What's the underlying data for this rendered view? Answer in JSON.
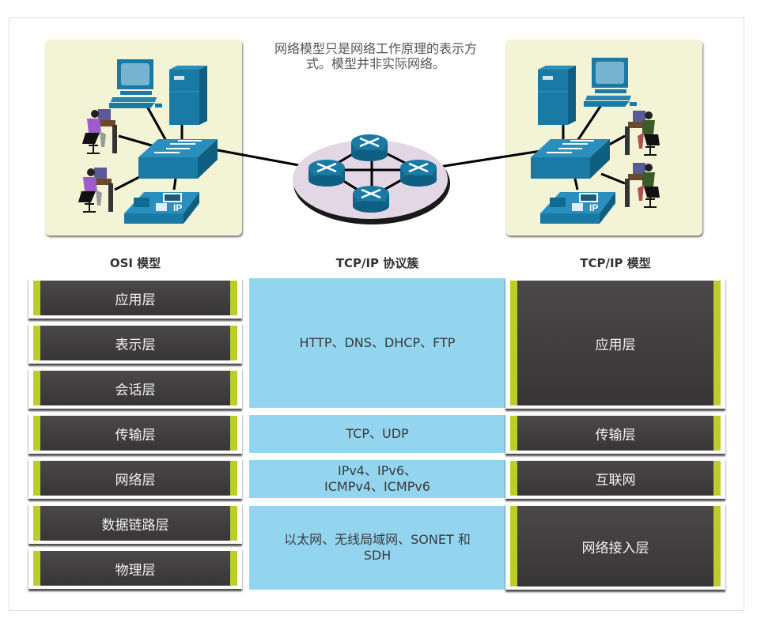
{
  "caption": "网络模型只是网络工作原理的表示方式。模型并非实际网络。",
  "caption_lines": [
    "网络模型只是网络工作原理的表示方",
    "式。模型并非实际网络。"
  ],
  "headers": {
    "osi": "OSI 模型",
    "suite": "TCP/IP 协议簇",
    "tcpip": "TCP/IP 模型"
  },
  "osi_layers": [
    {
      "label": "应用层"
    },
    {
      "label": "表示层"
    },
    {
      "label": "会话层"
    },
    {
      "label": "传输层"
    },
    {
      "label": "网络层"
    },
    {
      "label": "数据链路层"
    },
    {
      "label": "物理层"
    }
  ],
  "protocols": [
    {
      "lines": [
        "HTTP、DNS、DHCP、FTP"
      ]
    },
    {
      "lines": [
        "TCP、UDP"
      ]
    },
    {
      "lines": [
        "IPv4、IPv6、",
        "ICMPv4、ICMPv6"
      ]
    },
    {
      "lines": [
        "以太网、无线局域网、SONET 和",
        "SDH"
      ]
    }
  ],
  "tcpip_layers": [
    {
      "label": "应用层"
    },
    {
      "label": "传输层"
    },
    {
      "label": "互联网"
    },
    {
      "label": "网络接入层"
    }
  ],
  "diagram": {
    "phone_label": "IP",
    "devices": [
      "server",
      "pc",
      "switch",
      "ip-phone",
      "user-workstation",
      "user-workstation",
      "router",
      "router",
      "router",
      "router"
    ]
  },
  "colors": {
    "panel_bg": "#f3f3d6",
    "device_blue": "#1a7aa6",
    "layer_dark": "#403d3e",
    "layer_accent": "#bccd2a",
    "protocol_bg": "#93d5ef",
    "cloud": "#e3d7e6"
  }
}
